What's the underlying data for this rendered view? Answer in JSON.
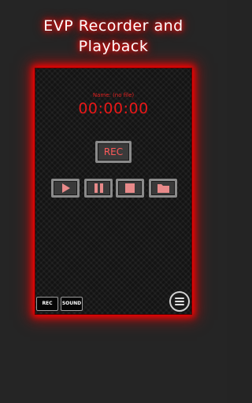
{
  "app": {
    "title_line1": "EVP Recorder and",
    "title_line2": "Playback"
  },
  "recorder": {
    "file_label": "Name: (no file)",
    "timer": "00:00:00",
    "rec_label": "REC"
  },
  "controls": [
    {
      "icon": "play-icon"
    },
    {
      "icon": "pause-icon"
    },
    {
      "icon": "stop-icon"
    },
    {
      "icon": "folder-icon"
    }
  ],
  "bottom_bar": {
    "rec_label": "REC",
    "sound_label": "SOUND",
    "menu_icon": "hamburger-menu-icon"
  },
  "colors": {
    "accent_red": "#e81818",
    "glow_red": "#ff0000",
    "background": "#252525",
    "panel": "#131313"
  }
}
